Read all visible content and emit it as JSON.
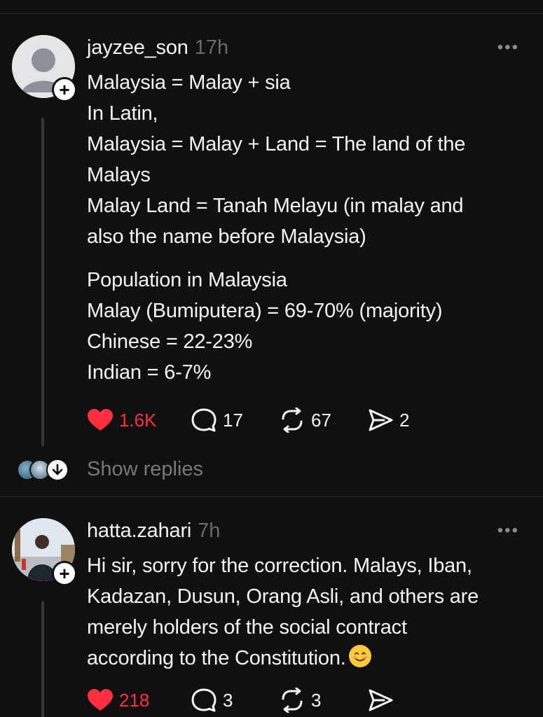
{
  "posts": [
    {
      "username": "jayzee_son",
      "time": "17h",
      "more_icon": "more-horizontal-icon",
      "lines": [
        "Malaysia = Malay + sia",
        "In Latin,",
        "Malaysia = Malay + Land = The land of the",
        "Malays",
        "Malay Land = Tanah Melayu (in malay and",
        "also the name before Malaysia)",
        "Population in Malaysia",
        "Malay (Bumiputera) = 69-70% (majority)",
        "Chinese = 22-23%",
        "Indian = 6-7%"
      ],
      "likes": "1.6K",
      "replies": "17",
      "reposts": "67",
      "shares": "2",
      "liked": true
    },
    {
      "username": "hatta.zahari",
      "time": "7h",
      "more_icon": "more-horizontal-icon",
      "lines": [
        "Hi sir, sorry for the correction. Malays, Iban,",
        "Kadazan, Dusun, Orang Asli, and others are",
        "merely holders of the social contract",
        "according to the Constitution."
      ],
      "emoji": "smiling-face-emoji",
      "likes": "218",
      "replies": "3",
      "reposts": "3",
      "liked": true
    }
  ],
  "show_replies": "Show replies",
  "colors": {
    "background": "#101010",
    "text": "#f3f5f7",
    "muted": "#6a6a6a",
    "like": "#ff3040",
    "divider": "#2a2a2a"
  }
}
